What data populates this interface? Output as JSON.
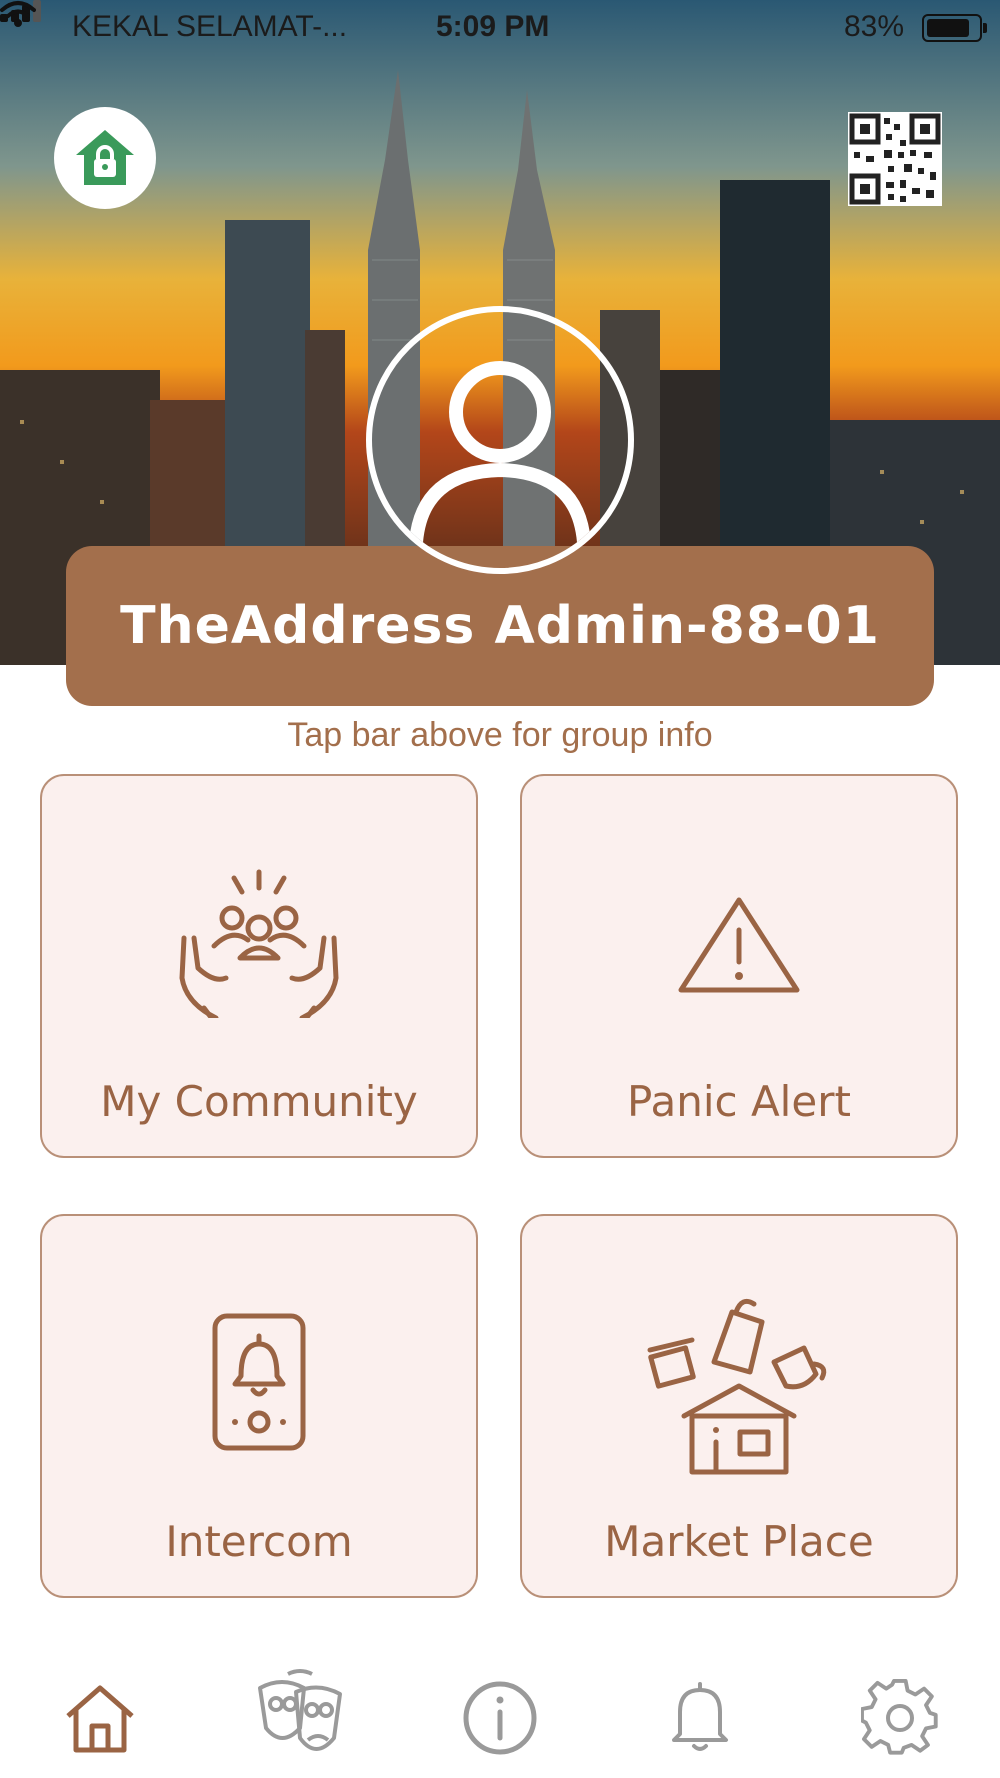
{
  "status_bar": {
    "carrier": "KEKAL SELAMAT-...",
    "time": "5:09 PM",
    "battery": "83%",
    "battery_level": 0.83
  },
  "header": {
    "group_name": "TheAddress Admin-88-01",
    "hint": "Tap bar above for group info",
    "icons": {
      "left": "home-lock-icon",
      "right": "qr-code-icon",
      "avatar": "user-avatar-icon"
    }
  },
  "tiles": [
    {
      "label": "My Community",
      "icon": "community-hands-icon"
    },
    {
      "label": "Panic Alert",
      "icon": "warning-triangle-icon"
    },
    {
      "label": "Intercom",
      "icon": "intercom-bell-icon"
    },
    {
      "label": "Market Place",
      "icon": "market-shop-icon"
    }
  ],
  "tab_bar": {
    "items": [
      {
        "icon": "home-icon",
        "active": true
      },
      {
        "icon": "masks-icon",
        "active": false
      },
      {
        "icon": "info-icon",
        "active": false
      },
      {
        "icon": "bell-icon",
        "active": false
      },
      {
        "icon": "gear-icon",
        "active": false
      }
    ]
  },
  "colors": {
    "brand_brown": "#a36f4c",
    "tile_bg": "#fbf0ee",
    "tile_border": "#b99078",
    "lock_green": "#3a9a5a",
    "tab_inactive": "#9a9a9a"
  }
}
